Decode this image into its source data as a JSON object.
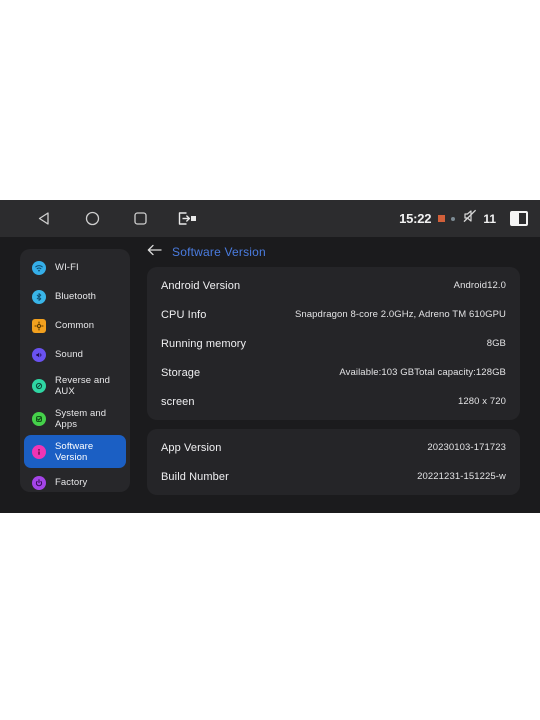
{
  "statusbar": {
    "nav": [
      {
        "name": "back-nav-icon",
        "glyph": "triangle-left"
      },
      {
        "name": "home-nav-icon",
        "glyph": "circle"
      },
      {
        "name": "recents-nav-icon",
        "glyph": "square"
      },
      {
        "name": "exit-app-icon",
        "glyph": "exit"
      }
    ],
    "clock": "15:22",
    "mute_count": "11",
    "icons": {
      "orange_square": "recording-indicator-icon",
      "teal_dot": "status-dot-icon",
      "mute": "volume-muted-icon",
      "split": "split-screen-icon"
    }
  },
  "sidebar": {
    "items": [
      {
        "label": "WI-FI",
        "icon": "wifi-icon",
        "color": "#35aee8",
        "shape": "circle",
        "active": false
      },
      {
        "label": "Bluetooth",
        "icon": "bluetooth-icon",
        "color": "#39b5e8",
        "shape": "circle",
        "active": false
      },
      {
        "label": "Common",
        "icon": "gear-icon",
        "color": "#f2a01e",
        "shape": "square",
        "active": false
      },
      {
        "label": "Sound",
        "icon": "speaker-icon",
        "color": "#6a52f0",
        "shape": "circle",
        "active": false
      },
      {
        "label": "Reverse and AUX",
        "icon": "camera-icon",
        "color": "#2fd6a3",
        "shape": "circle",
        "active": false
      },
      {
        "label": "System and Apps",
        "icon": "apps-icon",
        "color": "#45d14a",
        "shape": "circle",
        "active": false
      },
      {
        "label": "Software Version",
        "icon": "info-icon",
        "color": "#ef35b5",
        "shape": "circle",
        "active": true
      },
      {
        "label": "Factory",
        "icon": "power-icon",
        "color": "#a544e8",
        "shape": "circle",
        "active": false
      }
    ]
  },
  "main": {
    "back_icon": "back-arrow-icon",
    "title": "Software Version",
    "cards": [
      {
        "rows": [
          {
            "label": "Android Version",
            "value": "Android12.0"
          },
          {
            "label": "CPU Info",
            "value": "Snapdragon 8-core 2.0GHz, Adreno TM 610GPU"
          },
          {
            "label": "Running memory",
            "value": "8GB"
          },
          {
            "label": "Storage",
            "value": "Available:103 GBTotal capacity:128GB"
          },
          {
            "label": "screen",
            "value": "1280 x 720"
          }
        ]
      },
      {
        "rows": [
          {
            "label": "App Version",
            "value": "20230103-171723"
          },
          {
            "label": "Build Number",
            "value": "20221231-151225-w"
          }
        ]
      }
    ]
  },
  "colors": {
    "accent_blue": "#1b5fc4",
    "title_blue": "#4a7ce0",
    "panel_bg": "#1b1b1d",
    "card_bg": "#252528",
    "statusbar_bg": "#2c2c2e"
  }
}
